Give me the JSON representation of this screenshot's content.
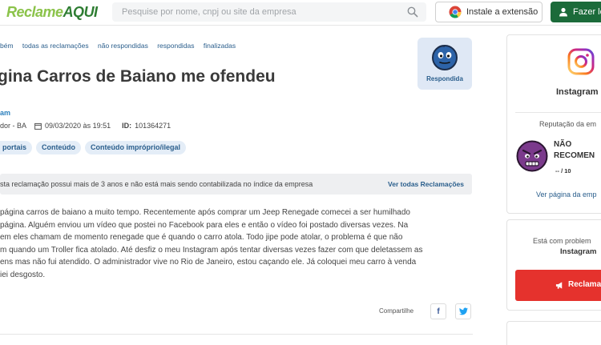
{
  "header": {
    "logo_part1": "Reclame",
    "logo_part2": "AQUI",
    "search_placeholder": "Pesquise por nome, cnpj ou site da empresa",
    "extension_button": "Instale a extensão",
    "login_button": "Fazer lo"
  },
  "breadcrumbs": [
    "bém",
    "todas as reclamações",
    "não respondidas",
    "respondidas",
    "finalizadas"
  ],
  "complaint": {
    "title": "gina Carros de Baiano me ofendeu",
    "status_badge": "Respondida",
    "author": "am",
    "location": "dor - BA",
    "date": "09/03/2020 às 19:51",
    "id_label": "ID:",
    "id_value": "101364271",
    "tags": [
      "portais",
      "Conteúdo",
      "Conteúdo impróprio/ilegal"
    ],
    "notice": "sta reclamação possui mais de 3 anos e não está mais sendo contabilizada no índice da empresa",
    "notice_link": "Ver todas Reclamações",
    "body_lines": [
      "página carros de baiano a muito tempo. Recentemente após comprar um Jeep Renegade comecei a ser humilhado",
      "página. Alguém enviou um vídeo que postei no Facebook para eles e então o vídeo foi postado diversas vezes. Na",
      "em eles chamam de momento renegade que é quando o carro atola. Todo jipe pode atolar, o problema é que não",
      "m quando um Troller fica atolado. Até desfiz o meu Instagram após tentar diversas vezes fazer com que deletassem as",
      "ens mas não fui atendido. O administrador vive no Rio de Janeiro, estou caçando ele. Já coloquei meu carro à venda",
      "iei desgosto."
    ],
    "share_label": "Compartilhe",
    "facebook_glyph": "f",
    "twitter_glyph": "t"
  },
  "company_card": {
    "name": "Instagram",
    "reputation_label": "Reputação da em",
    "status_line1": "NÃO",
    "status_line2": "RECOMEN",
    "score": "-- / 10",
    "view_page_link": "Ver página da emp"
  },
  "problem_card": {
    "question": "Está com problem",
    "company": "Instagram",
    "button": "Reclama"
  },
  "colors": {
    "brand_green": "#1b6b3a",
    "link_blue": "#2a5e8c",
    "badge_bg": "#dfe8f5",
    "reclame_red": "#e5322d"
  }
}
